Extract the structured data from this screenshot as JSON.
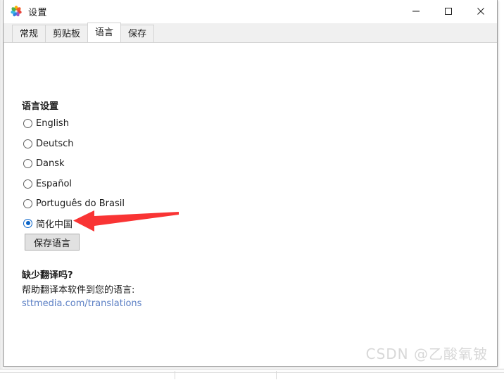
{
  "window": {
    "title": "设置",
    "icon": "photos-flower-icon",
    "controls": {
      "minimize": "minimize-icon",
      "maximize": "maximize-icon",
      "close": "close-icon"
    }
  },
  "tabs": [
    {
      "label": "常规",
      "active": false
    },
    {
      "label": "剪贴板",
      "active": false
    },
    {
      "label": "语言",
      "active": true
    },
    {
      "label": "保存",
      "active": false
    }
  ],
  "language_panel": {
    "heading": "语言设置",
    "options": [
      {
        "label": "English",
        "selected": false
      },
      {
        "label": "Deutsch",
        "selected": false
      },
      {
        "label": "Dansk",
        "selected": false
      },
      {
        "label": "Español",
        "selected": false
      },
      {
        "label": "Português do Brasil",
        "selected": false
      },
      {
        "label": "简化中国",
        "selected": true
      }
    ],
    "save_button": "保存语言"
  },
  "help_section": {
    "heading": "缺少翻译吗?",
    "text": "帮助翻译本软件到您的语言:",
    "link": "sttmedia.com/translations"
  },
  "annotation": {
    "type": "red-arrow",
    "color": "#f93434",
    "points_to": "简化中国"
  },
  "watermark": "CSDN @乙酸氧铍",
  "colors": {
    "accent": "#0a64c8",
    "link": "#5b7fc4",
    "arrow": "#f93434",
    "tabstrip_bg": "#f0f0f0",
    "button_bg": "#e1e1e1"
  }
}
